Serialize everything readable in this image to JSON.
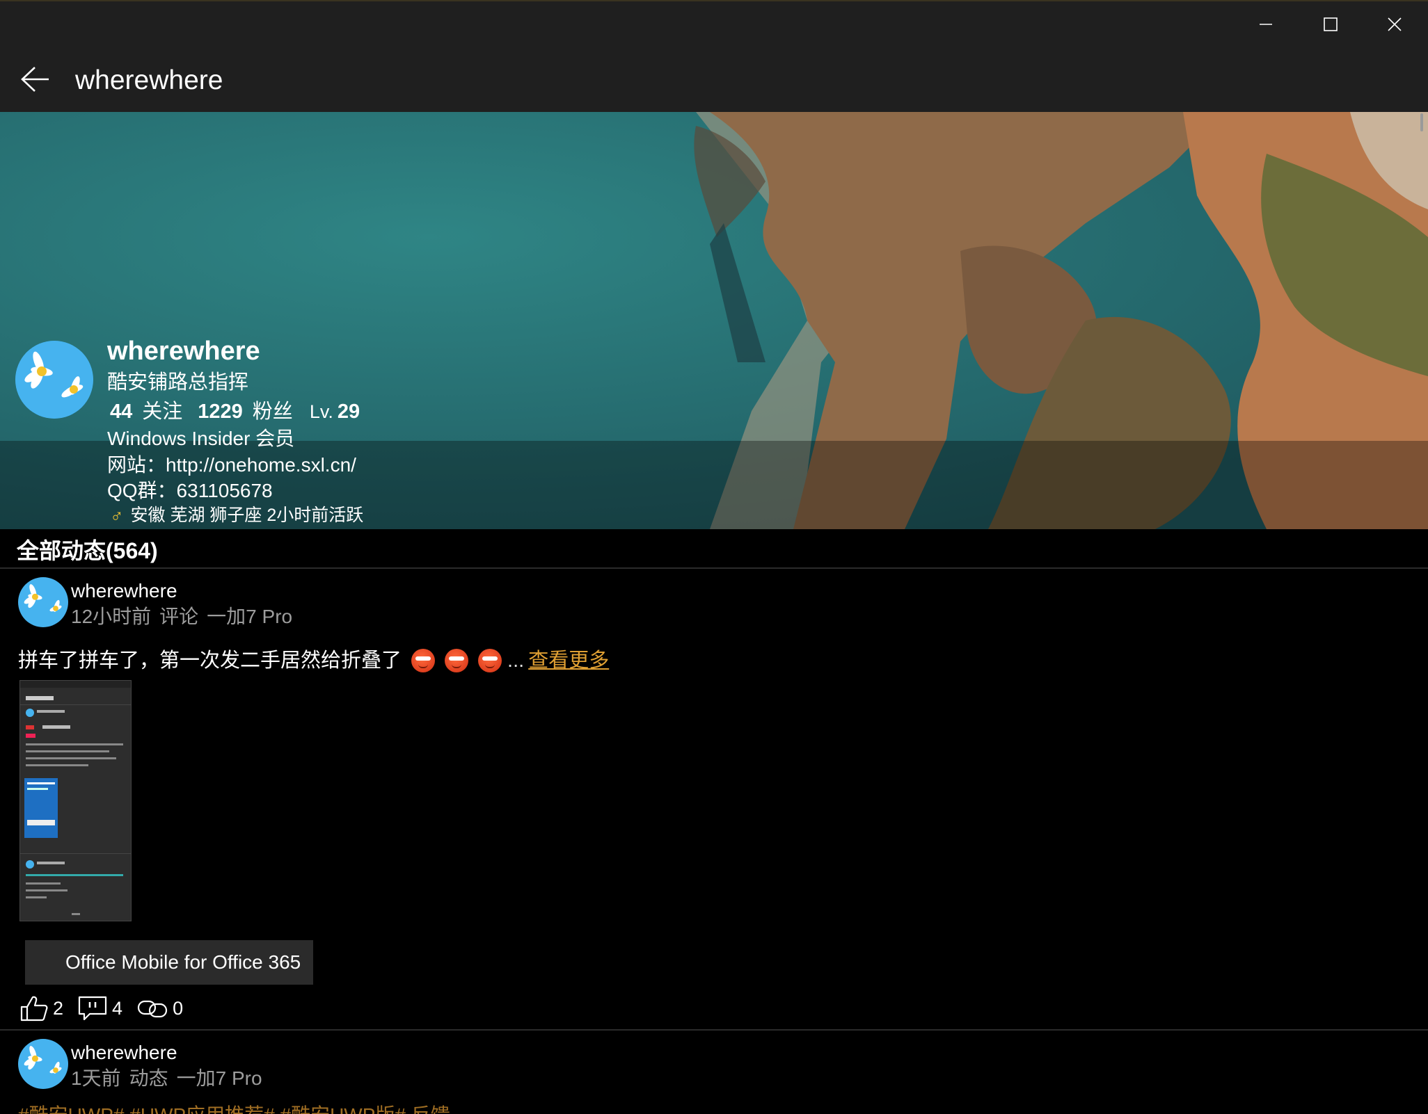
{
  "window": {
    "title": "wherewhere",
    "controls": [
      "minimize-icon",
      "maximize-icon",
      "close-icon"
    ]
  },
  "profile": {
    "name": "wherewhere",
    "subtitle": "酷安铺路总指挥",
    "follow_count": "44",
    "follow_label": "关注",
    "fans_count": "1229",
    "fans_label": "粉丝",
    "level_label": "Lv.",
    "level": "29",
    "bio_lines": [
      "Windows Insider 会员",
      "网站：http://onehome.sxl.cn/",
      "QQ群：631105678"
    ],
    "gender_icon": "♂",
    "location_line": "安徽 芜湖 狮子座 2小时前活跃"
  },
  "feed": {
    "header": "全部动态(564)",
    "posts": [
      {
        "user": "wherewhere",
        "time": "12小时前",
        "type": "评论",
        "device": "一加7 Pro",
        "text": "拼车了拼车了，第一次发二手居然给折叠了",
        "emoji_count": 3,
        "ellipsis": "...",
        "see_more": "查看更多",
        "app_chip": "Office Mobile for Office 365",
        "likes": "2",
        "comments": "4",
        "shares": "0"
      },
      {
        "user": "wherewhere",
        "time": "1天前",
        "type": "动态",
        "device": "一加7 Pro",
        "tags_peek": "#酷安UWP# #UWP应用推荐# #酷安UWP版# 反馈"
      }
    ]
  },
  "colors": {
    "titlebar": "#1f1f1f",
    "background": "#000000",
    "meta_text": "#9d9d9d",
    "accent_link": "#e0a033",
    "gender": "#f2c432"
  }
}
